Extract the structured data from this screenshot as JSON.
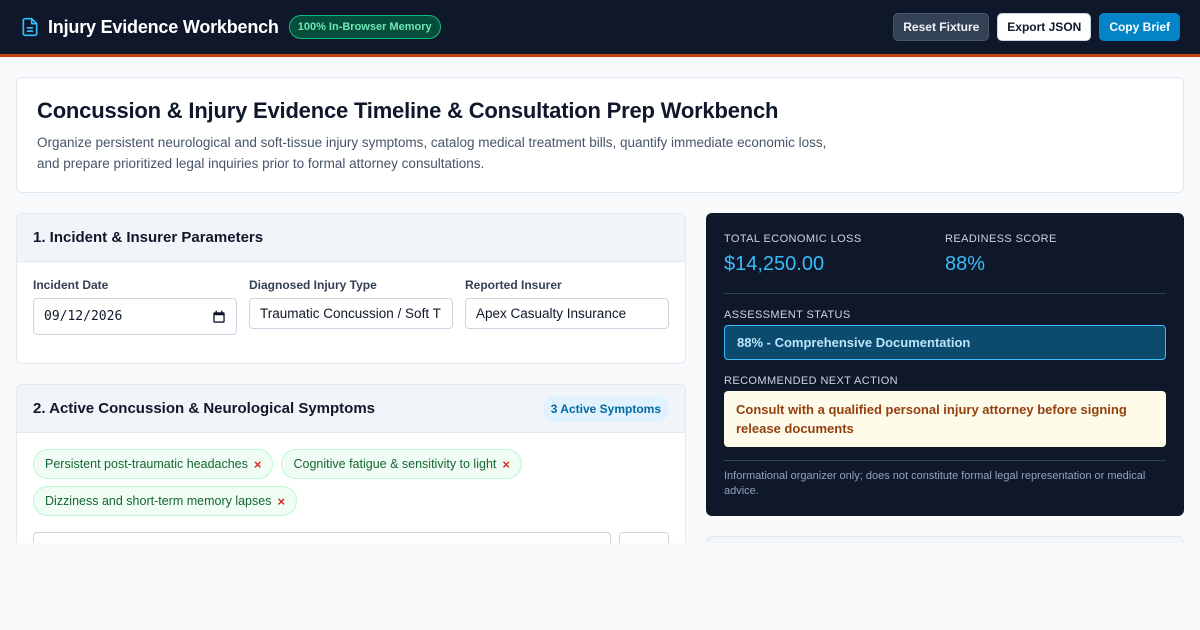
{
  "app": {
    "title": "Injury Evidence Workbench",
    "memory_badge": "100% In-Browser Memory",
    "buttons": {
      "reset": "Reset Fixture",
      "export": "Export JSON",
      "copy": "Copy Brief"
    },
    "accent": "#c2410c",
    "icon": "document-icon"
  },
  "hero": {
    "title": "Concussion & Injury Evidence Timeline & Consultation Prep Workbench",
    "description": "Organize persistent neurological and soft-tissue injury symptoms, catalog medical treatment bills, quantify immediate economic loss, and prepare prioritized legal inquiries prior to formal attorney consultations."
  },
  "incident": {
    "heading": "1. Incident & Insurer Parameters",
    "date_label": "Incident Date",
    "date_value": "09/12/2026",
    "injury_label": "Diagnosed Injury Type",
    "injury_value": "Traumatic Concussion / Soft T",
    "insurer_label": "Reported Insurer",
    "insurer_value": "Apex Casualty Insurance"
  },
  "symptoms": {
    "heading": "2. Active Concussion & Neurological Symptoms",
    "count_badge": "3 Active Symptoms",
    "items": [
      {
        "label": "Persistent post-traumatic headaches",
        "remove": "×"
      },
      {
        "label": "Cognitive fatigue & sensitivity to light",
        "remove": "×"
      },
      {
        "label": "Dizziness and short-term memory lapses",
        "remove": "×"
      }
    ]
  },
  "summary": {
    "loss_label": "TOTAL ECONOMIC LOSS",
    "loss_value": "$14,250.00",
    "readiness_label": "READINESS SCORE",
    "readiness_value": "88%",
    "status_label": "ASSESSMENT STATUS",
    "status_value": "88% - Comprehensive Documentation",
    "action_label": "RECOMMENDED NEXT ACTION",
    "action_value": "Consult with a qualified personal injury attorney before signing release documents",
    "disclaimer": "Informational organizer only; does not constitute formal legal representation or medical advice."
  }
}
